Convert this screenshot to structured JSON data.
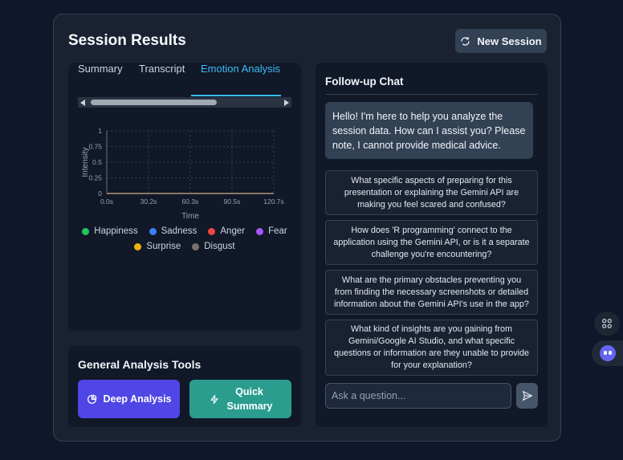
{
  "page": {
    "title": "Session Results",
    "new_session_label": "New Session"
  },
  "tabs": [
    "Summary",
    "Transcript",
    "Emotion Analysis"
  ],
  "active_tab": "Emotion Analysis",
  "chart_data": {
    "type": "line",
    "xlabel": "Time",
    "ylabel": "Intensity",
    "x_ticks": [
      "0.0s",
      "30.2s",
      "60.3s",
      "90.5s",
      "120.7s"
    ],
    "y_ticks": [
      "0",
      "0.25",
      "0.5",
      "0.75",
      "1"
    ],
    "xlim": [
      0,
      120.7
    ],
    "ylim": [
      0,
      1
    ],
    "grid": true,
    "legend_position": "bottom",
    "x": [
      0,
      30.2,
      60.3,
      90.5,
      120.7
    ],
    "series": [
      {
        "name": "Happiness",
        "color": "#22c55e",
        "values": [
          0,
          0,
          0,
          0,
          0
        ]
      },
      {
        "name": "Sadness",
        "color": "#3b82f6",
        "values": [
          0,
          0,
          0,
          0,
          0
        ]
      },
      {
        "name": "Anger",
        "color": "#ef4444",
        "values": [
          0,
          0,
          0,
          0,
          0
        ]
      },
      {
        "name": "Fear",
        "color": "#a855f7",
        "values": [
          0,
          0,
          0,
          0,
          0
        ]
      },
      {
        "name": "Surprise",
        "color": "#eab308",
        "values": [
          0,
          0,
          0,
          0,
          0
        ]
      },
      {
        "name": "Disgust",
        "color": "#78716c",
        "values": [
          0,
          0,
          0,
          0,
          0
        ]
      }
    ]
  },
  "tools": {
    "title": "General Analysis Tools",
    "deep_label": "Deep Analysis",
    "quick_label": "Quick Summary"
  },
  "chat": {
    "title": "Follow-up Chat",
    "bot_message": "Hello! I'm here to help you analyze the session data. How can I assist you? Please note, I cannot provide medical advice.",
    "suggestions": [
      "What specific aspects of preparing for this presentation or explaining the Gemini API are making you feel scared and confused?",
      "How does 'R programming' connect to the application using the Gemini API, or is it a separate challenge you're encountering?",
      "What are the primary obstacles preventing you from finding the necessary screenshots or detailed information about the Gemini API's use in the app?",
      "What kind of insights are you gaining from Gemini/Google AI Studio, and what specific questions or information are they unable to provide for your explanation?"
    ],
    "input_placeholder": "Ask a question..."
  },
  "colors": {
    "accent": "#38bdf8",
    "deep_button": "#4f46e5",
    "quick_button": "#2a9d8f"
  }
}
